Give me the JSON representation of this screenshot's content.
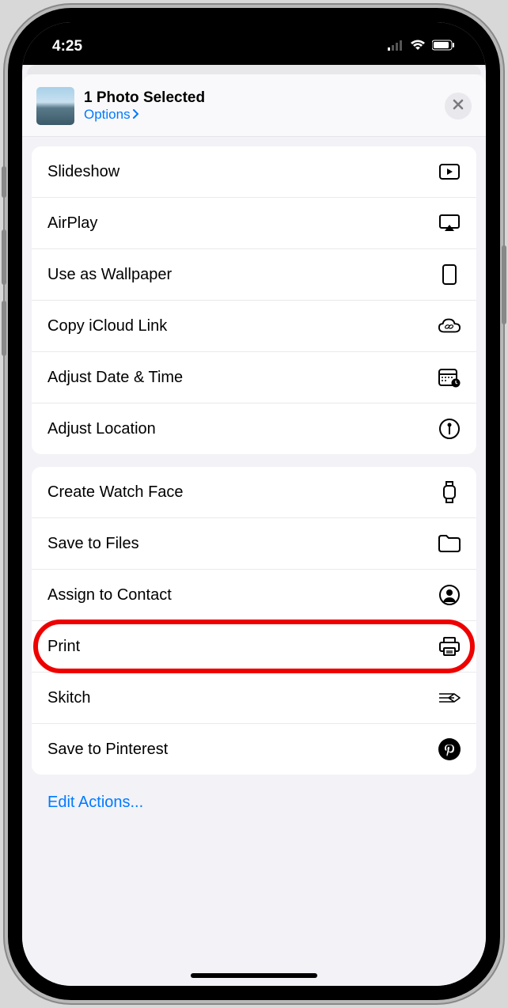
{
  "status": {
    "time": "4:25"
  },
  "header": {
    "title": "1 Photo Selected",
    "options": "Options"
  },
  "groups": [
    {
      "items": [
        {
          "name": "slideshow",
          "label": "Slideshow",
          "icon": "play-rect-icon"
        },
        {
          "name": "airplay",
          "label": "AirPlay",
          "icon": "airplay-icon"
        },
        {
          "name": "wallpaper",
          "label": "Use as Wallpaper",
          "icon": "phone-icon"
        },
        {
          "name": "icloud-link",
          "label": "Copy iCloud Link",
          "icon": "cloud-link-icon"
        },
        {
          "name": "adjust-date",
          "label": "Adjust Date & Time",
          "icon": "calendar-clock-icon"
        },
        {
          "name": "adjust-location",
          "label": "Adjust Location",
          "icon": "pin-circle-icon"
        }
      ]
    },
    {
      "items": [
        {
          "name": "watch-face",
          "label": "Create Watch Face",
          "icon": "watch-icon"
        },
        {
          "name": "save-files",
          "label": "Save to Files",
          "icon": "folder-icon"
        },
        {
          "name": "assign-contact",
          "label": "Assign to Contact",
          "icon": "person-circle-icon"
        },
        {
          "name": "print",
          "label": "Print",
          "icon": "printer-icon",
          "highlighted": true
        },
        {
          "name": "skitch",
          "label": "Skitch",
          "icon": "skitch-icon"
        },
        {
          "name": "pinterest",
          "label": "Save to Pinterest",
          "icon": "pinterest-icon"
        }
      ]
    }
  ],
  "edit_actions": "Edit Actions..."
}
